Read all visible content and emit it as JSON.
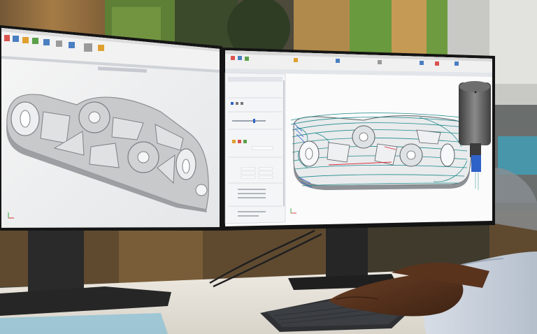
{
  "scene": {
    "description_colors": {
      "wall_green": "#6f8f3e",
      "wall_wood": "#a9783f",
      "desk": "#e9e5dc",
      "toolpath_accent": "#1f7f86",
      "tool_blue": "#2f62c9"
    }
  },
  "left_monitor": {
    "app_name": "",
    "part_color": "#c9cbcd"
  },
  "right_monitor": {
    "property_panel": {
      "rows": []
    },
    "toolpath_color": "#1f8a8a"
  }
}
